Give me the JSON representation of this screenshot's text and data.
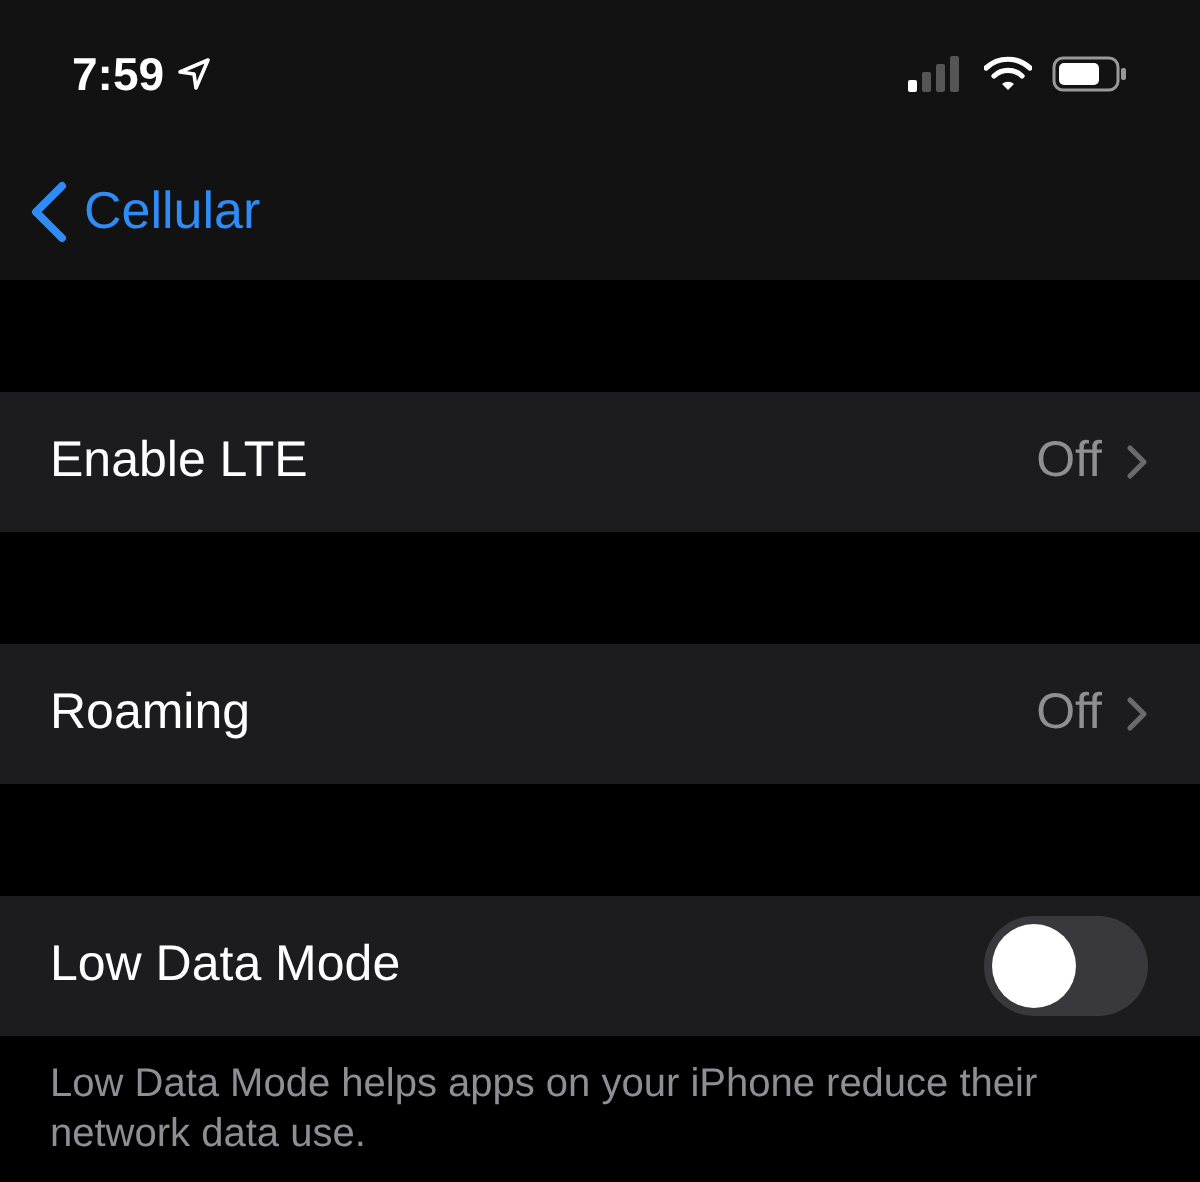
{
  "status_bar": {
    "time": "7:59"
  },
  "nav": {
    "back_label": "Cellular"
  },
  "rows": [
    {
      "kind": "disclosure",
      "label": "Enable LTE",
      "value": "Off"
    },
    {
      "kind": "disclosure",
      "label": "Roaming",
      "value": "Off"
    },
    {
      "kind": "toggle",
      "label": "Low Data Mode",
      "on": false
    }
  ],
  "footer": "Low Data Mode helps apps on your iPhone reduce their network data use."
}
